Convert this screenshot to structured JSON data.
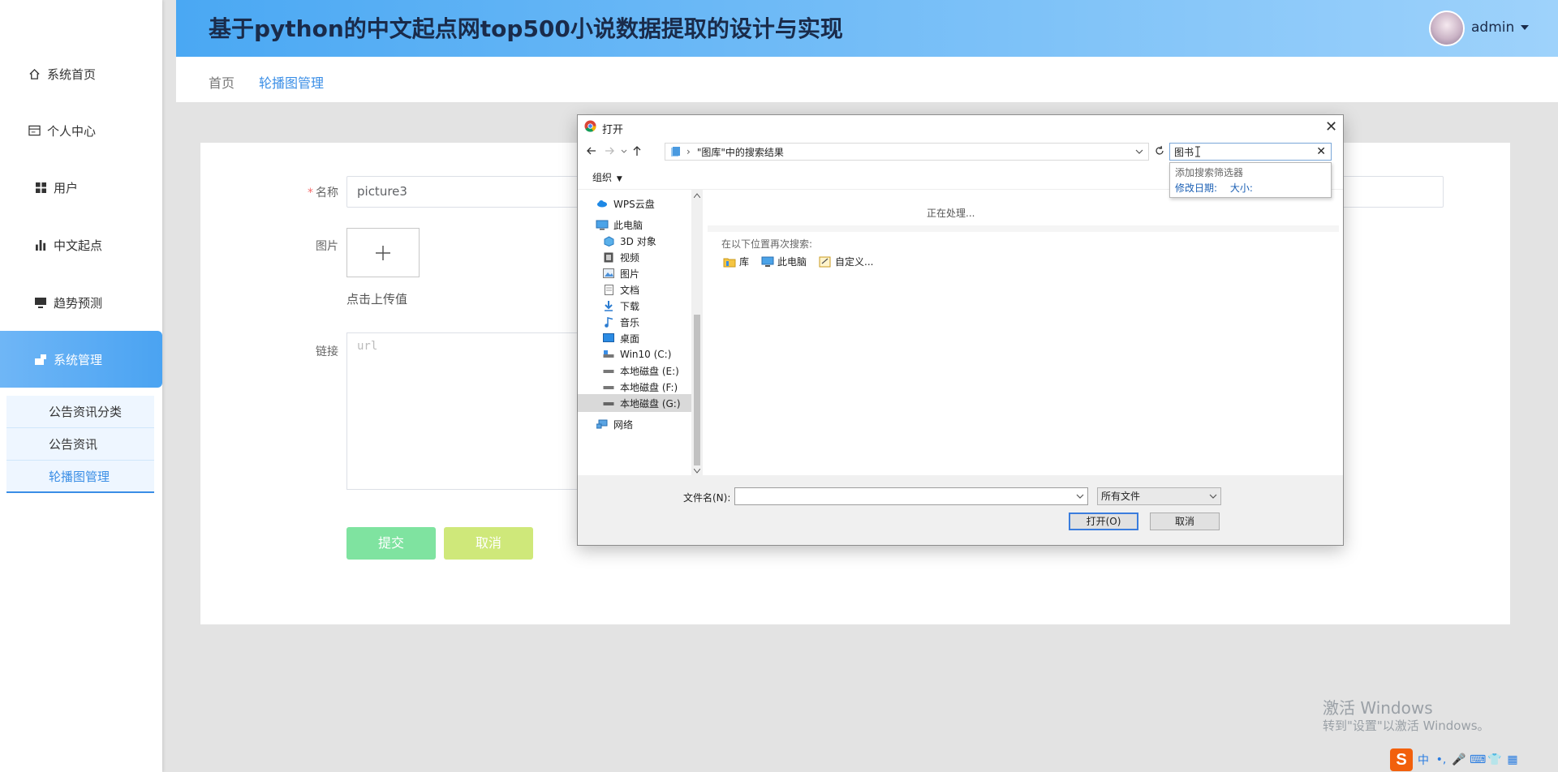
{
  "header": {
    "title": "基于python的中文起点网top500小说数据提取的设计与实现",
    "user": "admin"
  },
  "sidebar": {
    "items": [
      {
        "label": "系统首页",
        "icon": "home-icon"
      },
      {
        "label": "个人中心",
        "icon": "profile-card-icon"
      },
      {
        "label": "用户",
        "icon": "grid-icon"
      },
      {
        "label": "中文起点",
        "icon": "bar-chart-icon"
      },
      {
        "label": "趋势预测",
        "icon": "monitor-icon"
      },
      {
        "label": "系统管理",
        "icon": "settings-icon"
      }
    ],
    "submenu": [
      "公告资讯分类",
      "公告资讯",
      "轮播图管理"
    ]
  },
  "breadcrumb": {
    "home": "首页",
    "current": "轮播图管理"
  },
  "form": {
    "name_label": "名称",
    "name_value": "picture3",
    "image_label": "图片",
    "upload_hint": "点击上传值",
    "link_label": "链接",
    "link_placeholder": "url",
    "submit": "提交",
    "cancel": "取消"
  },
  "watermark": {
    "line1": "激活 Windows",
    "line2": "转到\"设置\"以激活 Windows。"
  },
  "tray": {
    "ime": "中"
  },
  "dialog": {
    "title": "打开",
    "address": "\"图库\"中的搜索结果",
    "search_value": "图书",
    "organize": "组织",
    "suggest_title": "添加搜索筛选器",
    "suggest_date": "修改日期:",
    "suggest_size": "大小:",
    "tree": [
      {
        "label": "WPS云盘",
        "icon": "cloud-icon"
      },
      {
        "label": "此电脑",
        "icon": "computer-icon"
      },
      {
        "label": "3D 对象",
        "icon": "cube-icon"
      },
      {
        "label": "视频",
        "icon": "video-icon"
      },
      {
        "label": "图片",
        "icon": "picture-icon"
      },
      {
        "label": "文档",
        "icon": "document-icon"
      },
      {
        "label": "下载",
        "icon": "download-icon"
      },
      {
        "label": "音乐",
        "icon": "music-icon"
      },
      {
        "label": "桌面",
        "icon": "desktop-icon"
      },
      {
        "label": "Win10 (C:)",
        "icon": "drive-icon"
      },
      {
        "label": "本地磁盘 (E:)",
        "icon": "drive-icon"
      },
      {
        "label": "本地磁盘 (F:)",
        "icon": "drive-icon"
      },
      {
        "label": "本地磁盘 (G:)",
        "icon": "drive-icon"
      },
      {
        "label": "网络",
        "icon": "network-icon"
      }
    ],
    "processing": "正在处理...",
    "search_again": "在以下位置再次搜索:",
    "locations": [
      "库",
      "此电脑",
      "自定义..."
    ],
    "filename_label": "文件名(N):",
    "filename_value": "",
    "filetype": "所有文件",
    "open": "打开(O)",
    "cancel": "取消"
  }
}
